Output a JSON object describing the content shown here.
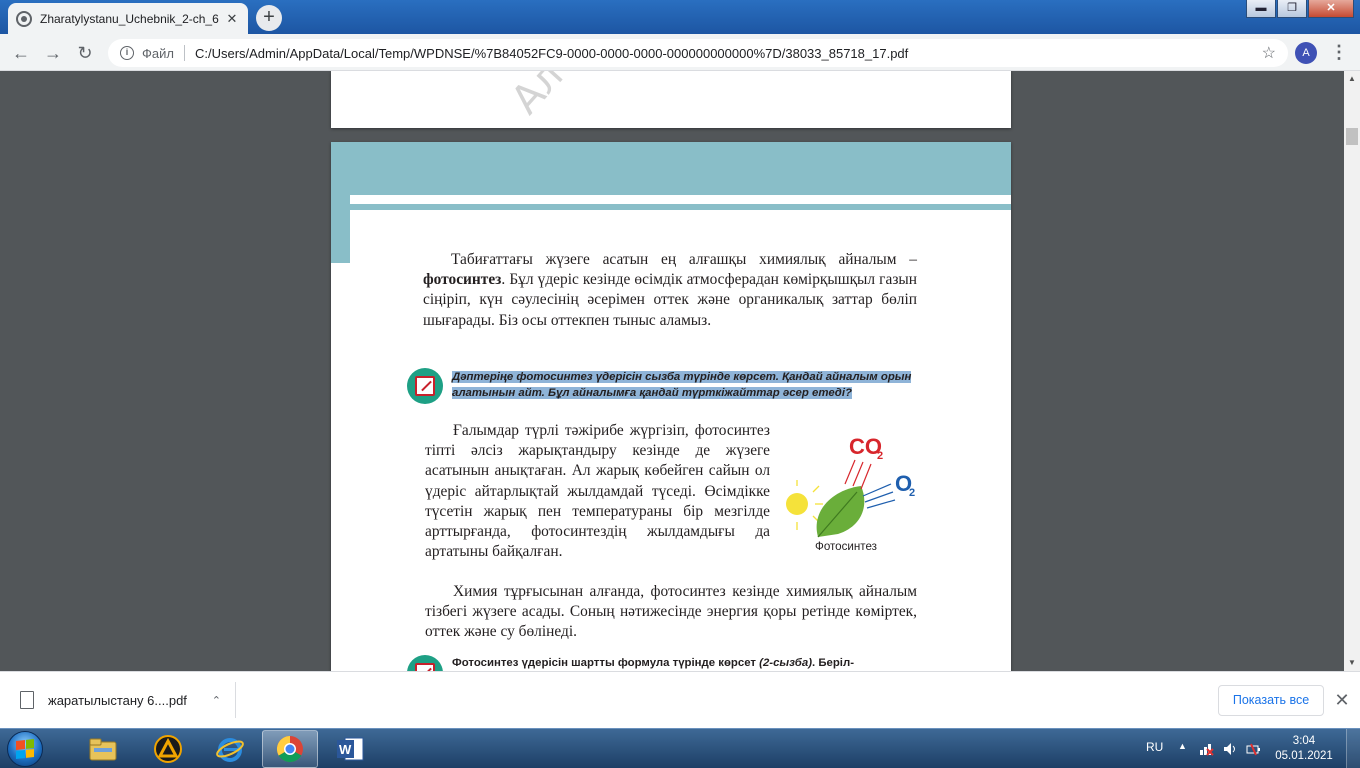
{
  "browser": {
    "tab_title": "Zharatylystanu_Uchebnik_2-ch_6",
    "tab_close": "✕",
    "new_tab": "+",
    "back": "←",
    "forward": "→",
    "reload": "↻",
    "scheme_label": "Файл",
    "url": "C:/Users/Admin/AppData/Local/Temp/WPDNSE/%7B84052FC9-0000-0000-0000-000000000000%7D/38033_85718_17.pdf",
    "bookmark_star": "☆",
    "profile_initial": "A",
    "menu": "⋮",
    "window_controls": {
      "minimize": "▬",
      "restore": "❐",
      "close": "✕"
    }
  },
  "pdf": {
    "watermark": "Ал",
    "paragraph1": {
      "before_bold": "Табиғаттағы жүзеге асатын ең алғашқы химиялық айналым – ",
      "bold": "фотосинтез",
      "after_bold": ". Бұл үдеріс кезінде өсімдік атмосферадан көмірқышқыл газын сіңіріп, күн сәулесінің әсерімен оттек және органикалық заттар бөліп шығарады. Біз осы оттекпен тыныс аламыз."
    },
    "task1": "Дәптеріңе фотосинтез үдерісін сызба түрінде көрсет. Қандай айналым орын алатынын айт. Бұл айналымға қандай түрткіжайттар әсер етеді?",
    "paragraph2": "Ғалымдар түрлі тәжірибе жүргізіп, фотосинтез тіпті әлсіз жарықтандыру кезінде де жүзеге асатынын анықтаған. Ал жарық көбейген сайын ол үдеріс айтарлықтай жылдамдай түседі. Өсімдікке түсетін жарық пен температураны бір мезгілде арттырғанда, фотосинтездің жылдамдығы да артатыны байқалған.",
    "paragraph3": "Химия тұрғысынан алғанда, фотосинтез кезінде химиялық айналым тізбегі жүзеге асады. Соның нәтижесінде энергия қоры ретінде көміртек, оттек және су бөлінеді.",
    "task2_main": "Фотосинтез үдерісін шартты формула түрінде көрсет ",
    "task2_ref": "(2-сызба)",
    "task2_tail": ". Беріл-",
    "figure": {
      "co2_label": "CO",
      "co2_sub": "2",
      "o2_label": "O",
      "o2_sub": "2",
      "caption": "Фотосинтез",
      "colors": {
        "sun": "#f5e23a",
        "leaf": "#6aae3a",
        "co2": "#d7262c",
        "o2": "#1f5fae"
      }
    }
  },
  "scrollbar": {
    "up": "▲",
    "down": "▼"
  },
  "downloads": {
    "file_name": "жаратылыстану 6....pdf",
    "chevron": "⌃",
    "show_all": "Показать все",
    "close": "✕"
  },
  "taskbar": {
    "language": "RU",
    "tray_arrow": "▲",
    "time": "3:04",
    "date": "05.01.2021"
  }
}
